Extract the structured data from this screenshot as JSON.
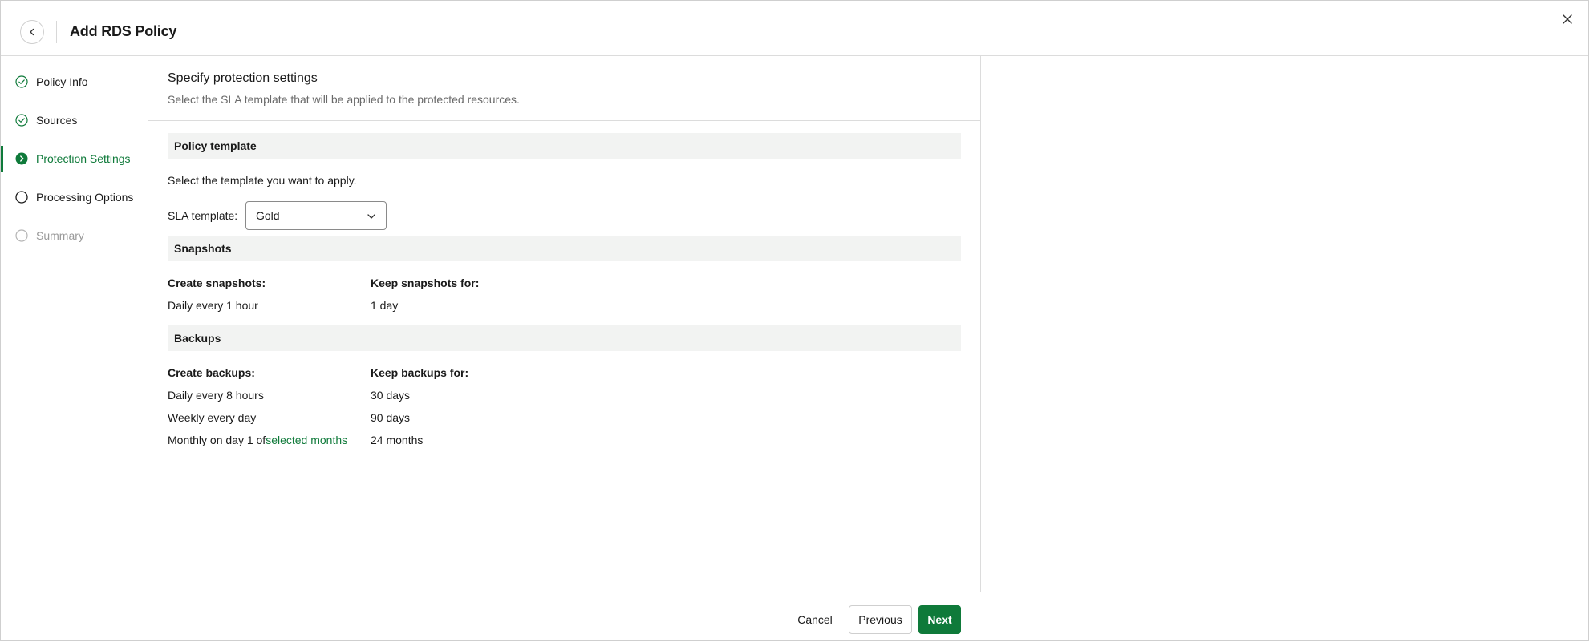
{
  "header": {
    "title": "Add RDS Policy",
    "back_icon": "chevron-left-icon",
    "close_icon": "close-icon"
  },
  "sidebar": {
    "steps": [
      {
        "label": "Policy Info",
        "status": "completed"
      },
      {
        "label": "Sources",
        "status": "completed"
      },
      {
        "label": "Protection Settings",
        "status": "active"
      },
      {
        "label": "Processing Options",
        "status": "pending"
      },
      {
        "label": "Summary",
        "status": "disabled"
      }
    ]
  },
  "main": {
    "title": "Specify protection settings",
    "subtitle": "Select the SLA template that will be applied to the protected resources.",
    "policy_template": {
      "heading": "Policy template",
      "instruction": "Select the template you want to apply.",
      "sla_label": "SLA template:",
      "sla_value": "Gold"
    },
    "snapshots": {
      "heading": "Snapshots",
      "create_label": "Create snapshots:",
      "keep_label": "Keep snapshots for:",
      "create_value": "Daily every 1 hour",
      "keep_value": "1 day"
    },
    "backups": {
      "heading": "Backups",
      "create_label": "Create backups:",
      "keep_label": "Keep backups for:",
      "rows": [
        {
          "schedule": "Daily every 8 hours",
          "retention": "30 days"
        },
        {
          "schedule": "Weekly every day",
          "retention": "90 days"
        },
        {
          "schedule_prefix": "Monthly on day 1 of",
          "schedule_link": "selected months",
          "retention": "24 months"
        }
      ]
    }
  },
  "footer": {
    "cancel": "Cancel",
    "previous": "Previous",
    "next": "Next"
  },
  "colors": {
    "accent": "#0f7a3a",
    "section_bg": "#f2f3f2",
    "border": "#dcdcdc"
  }
}
